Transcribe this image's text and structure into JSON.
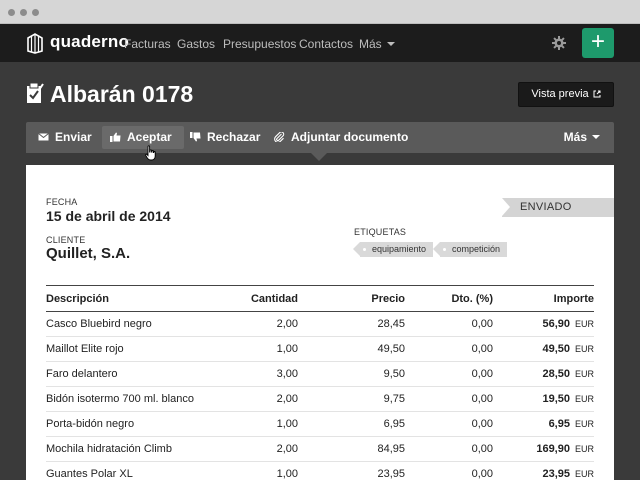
{
  "nav": {
    "brand": "quaderno",
    "items": [
      "Facturas",
      "Gastos",
      "Presupuestos",
      "Contactos"
    ],
    "more": "Más",
    "add_label": "+"
  },
  "page": {
    "title": "Albarán 0178",
    "preview_label": "Vista previa"
  },
  "toolbar": {
    "send": "Enviar",
    "accept": "Aceptar",
    "reject": "Rechazar",
    "attach": "Adjuntar documento",
    "more": "Más"
  },
  "document": {
    "date_label": "FECHA",
    "date": "15 de abril de 2014",
    "client_label": "CLIENTE",
    "client": "Quillet, S.A.",
    "tags_label": "ETIQUETAS",
    "tags": [
      "equipamiento",
      "competición"
    ],
    "status": "ENVIADO",
    "columns": {
      "description": "Descripción",
      "quantity": "Cantidad",
      "price": "Precio",
      "discount": "Dto. (%)",
      "amount": "Importe"
    },
    "rows": [
      {
        "description": "Casco Bluebird negro",
        "quantity": "2,00",
        "price": "28,45",
        "discount": "0,00",
        "amount": "56,90",
        "currency": "EUR"
      },
      {
        "description": "Maillot Elite rojo",
        "quantity": "1,00",
        "price": "49,50",
        "discount": "0,00",
        "amount": "49,50",
        "currency": "EUR"
      },
      {
        "description": "Faro delantero",
        "quantity": "3,00",
        "price": "9,50",
        "discount": "0,00",
        "amount": "28,50",
        "currency": "EUR"
      },
      {
        "description": "Bidón isotermo 700 ml. blanco",
        "quantity": "2,00",
        "price": "9,75",
        "discount": "0,00",
        "amount": "19,50",
        "currency": "EUR"
      },
      {
        "description": "Porta-bidón negro",
        "quantity": "1,00",
        "price": "6,95",
        "discount": "0,00",
        "amount": "6,95",
        "currency": "EUR"
      },
      {
        "description": "Mochila hidratación Climb",
        "quantity": "2,00",
        "price": "84,95",
        "discount": "0,00",
        "amount": "169,90",
        "currency": "EUR"
      },
      {
        "description": "Guantes Polar XL",
        "quantity": "1,00",
        "price": "23,95",
        "discount": "0,00",
        "amount": "23,95",
        "currency": "EUR"
      }
    ]
  },
  "colors": {
    "accent": "#1e9a6c",
    "navbar": "#1c1c1c",
    "background": "#3a3a3a",
    "toolbar": "#5a5a5a"
  }
}
